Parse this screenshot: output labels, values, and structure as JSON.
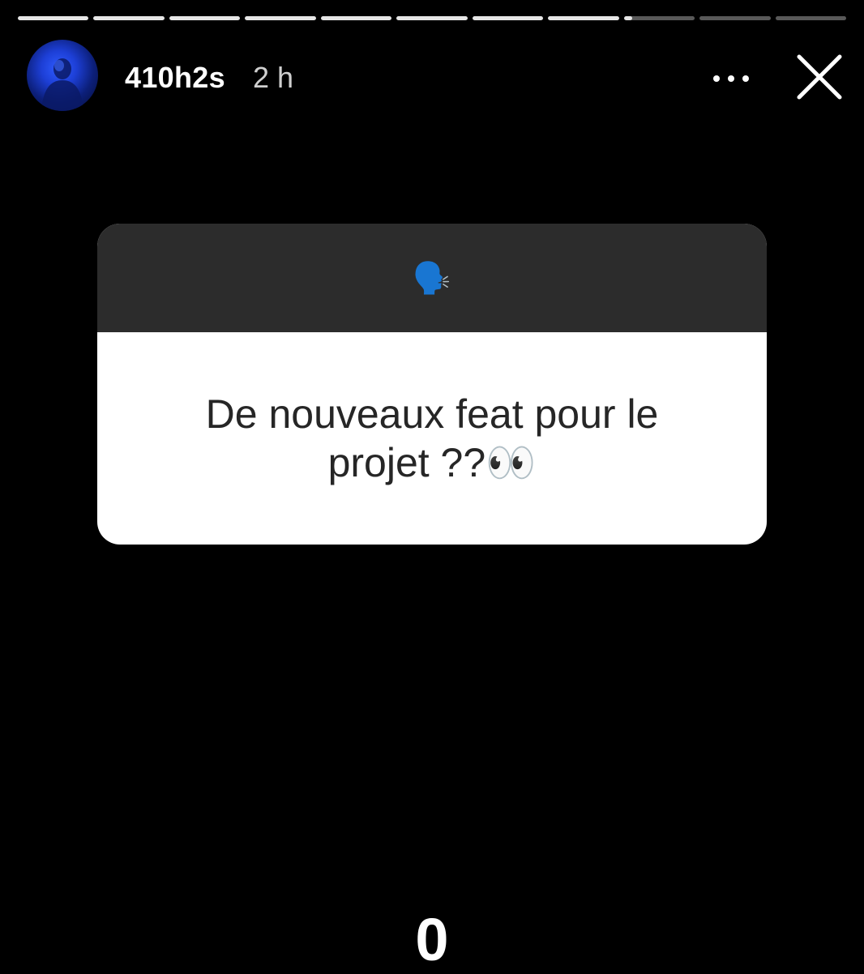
{
  "story": {
    "segment_count": 11,
    "current_segment_index": 8,
    "current_segment_progress": 0.12
  },
  "header": {
    "username": "410h2s",
    "timestamp": "2 h",
    "more_icon": "more-horizontal-icon",
    "close_icon": "close-icon"
  },
  "question_card": {
    "header_emoji": "🗣️",
    "question": "De nouveaux feat pour le projet ??👀"
  },
  "footer": {
    "count": "0"
  },
  "colors": {
    "background": "#000000",
    "card_header": "#2c2c2c",
    "card_body": "#ffffff",
    "question_text": "#262626"
  }
}
